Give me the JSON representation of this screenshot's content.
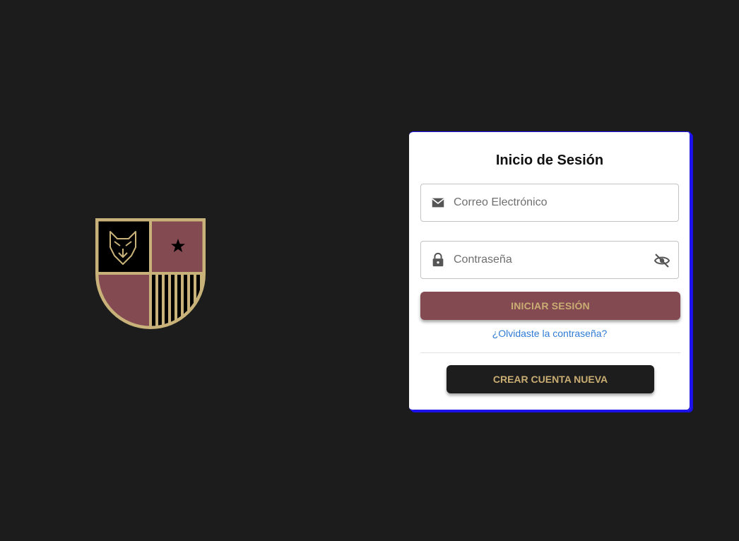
{
  "logo": {
    "name": "wolf-crest-logo",
    "colors": {
      "gold": "#c9b27a",
      "maroon": "#844a52",
      "black": "#000000"
    }
  },
  "login": {
    "title": "Inicio de Sesión",
    "email_placeholder": "Correo Electrónico",
    "password_placeholder": "Contraseña",
    "email_icon": "mail-icon",
    "password_icon": "lock-icon",
    "visibility_icon": "eye-off-icon",
    "submit_label": "INICIAR SESIÓN",
    "forgot_label": "¿Olvidaste la contraseña?",
    "create_label": "CREAR CUENTA NUEVA"
  },
  "colors": {
    "background": "#1c1c1c",
    "primary": "#844a52",
    "accent_text": "#c9ad73",
    "link": "#2f7bd6"
  }
}
